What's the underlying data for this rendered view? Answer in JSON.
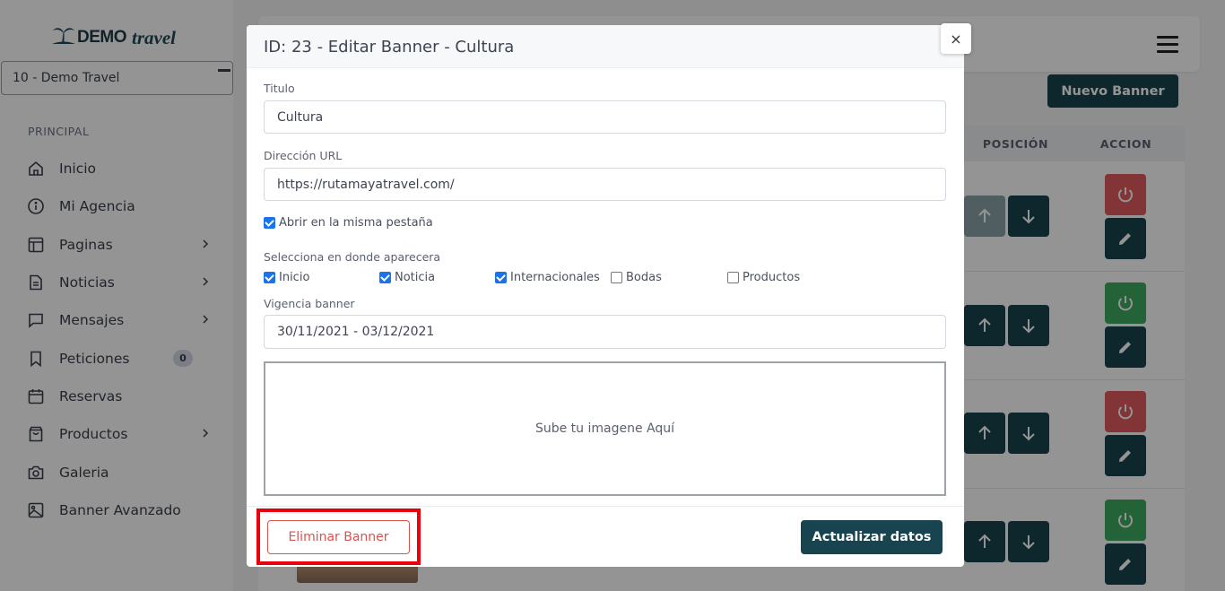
{
  "brand": {
    "logo_demo": "DEMO",
    "logo_travel": "travel"
  },
  "agency_select": {
    "value": "10 - Demo Travel"
  },
  "sidebar": {
    "section_label": "PRINCIPAL",
    "items": [
      {
        "label": "Inicio",
        "icon": "home-icon",
        "chevron": false
      },
      {
        "label": "Mi Agencia",
        "icon": "info-circle-icon",
        "chevron": false
      },
      {
        "label": "Paginas",
        "icon": "layout-icon",
        "chevron": true
      },
      {
        "label": "Noticias",
        "icon": "document-icon",
        "chevron": true
      },
      {
        "label": "Mensajes",
        "icon": "message-icon",
        "chevron": true
      },
      {
        "label": "Peticiones",
        "icon": "bookmark-icon",
        "chevron": false,
        "badge": "0"
      },
      {
        "label": "Reservas",
        "icon": "calendar-icon",
        "chevron": false
      },
      {
        "label": "Productos",
        "icon": "shopping-bag-icon",
        "chevron": true
      },
      {
        "label": "Galeria",
        "icon": "camera-icon",
        "chevron": false
      },
      {
        "label": "Banner Avanzado",
        "icon": "image-icon",
        "chevron": false
      }
    ]
  },
  "main": {
    "new_banner_label": "Nuevo Banner",
    "columns": {
      "position": "POSICIÓN",
      "action": "ACCION"
    },
    "row_power_colors": [
      "#e05a5e",
      "#3ea95f",
      "#e05a5e",
      "#3ea95f"
    ]
  },
  "modal": {
    "title": "ID: 23 - Editar Banner - Cultura",
    "close_label": "×",
    "fields": {
      "titulo_label": "Titulo",
      "titulo_value": "Cultura",
      "url_label": "Dirección URL",
      "url_value": "https://rutamayatravel.com/",
      "same_tab_label": "Abrir en la misma pestaña",
      "same_tab_checked": true,
      "locations_label": "Selecciona en donde aparecera",
      "locations": [
        {
          "label": "Inicio",
          "checked": true
        },
        {
          "label": "Noticia",
          "checked": true
        },
        {
          "label": "Internacionales",
          "checked": true
        },
        {
          "label": "Bodas",
          "checked": false
        },
        {
          "label": "Productos",
          "checked": false
        }
      ],
      "validity_label": "Vigencia banner",
      "validity_value": "30/11/2021 - 03/12/2021",
      "upload_text": "Sube tu imagene Aquí"
    },
    "delete_label": "Eliminar Banner",
    "update_label": "Actualizar datos"
  }
}
